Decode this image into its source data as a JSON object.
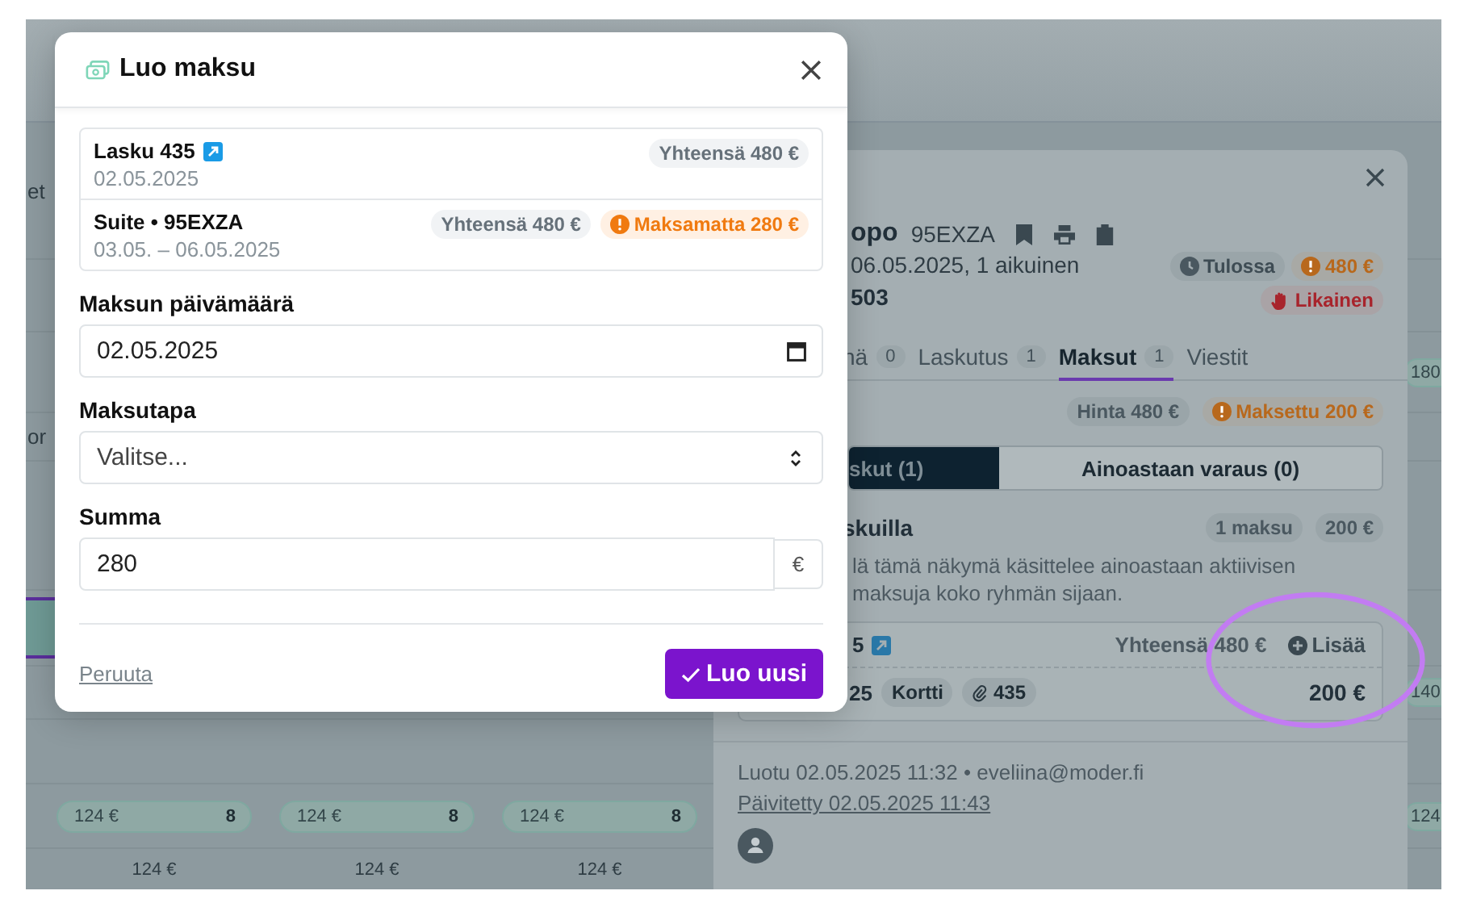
{
  "background": {
    "edge_labels": [
      "et",
      "or"
    ],
    "side_pills": [
      "180",
      "140",
      "124"
    ],
    "price_pills": [
      {
        "price": "124 €",
        "count": "8"
      },
      {
        "price": "124 €",
        "count": "8"
      },
      {
        "price": "124 €",
        "count": "8"
      }
    ],
    "row_prices": [
      "124 €",
      "124 €",
      "124 €"
    ]
  },
  "detail_panel": {
    "title": "opo",
    "code": "95EXZA",
    "dates": "06.05.2025, 1 aikuinen",
    "room": "503",
    "badges": [
      {
        "kind": "status",
        "text": "Tulossa"
      },
      {
        "kind": "warning",
        "text": "480 €"
      },
      {
        "kind": "danger",
        "text": "Likainen"
      }
    ],
    "tabs": [
      {
        "label": "nä",
        "count": "0",
        "selected": false
      },
      {
        "label": "Laskutus",
        "count": "1",
        "selected": false
      },
      {
        "label": "Maksut",
        "count": "1",
        "selected": true
      },
      {
        "label": "Viestit",
        "selected": false
      }
    ],
    "summary": [
      {
        "kind": "neutral",
        "text": "Hinta 480 €"
      },
      {
        "kind": "warning",
        "text": "Maksettu 200 €"
      }
    ],
    "segments": [
      {
        "label": "skut (1)",
        "selected": true
      },
      {
        "label": "Ainoastaan varaus (0)",
        "selected": false
      }
    ],
    "section": {
      "title": "skuilla",
      "badges": [
        "1 maksu",
        "200 €"
      ],
      "note": "lä tämä näkymä käsittelee ainoastaan aktiivisen\nmaksuja koko ryhmän sijaan."
    },
    "invoice_card": {
      "title": "5",
      "link": true,
      "total": "Yhteensä 480 €",
      "add": "Lisää",
      "payment": {
        "date": "25",
        "method": "Kortti",
        "invoice": "435",
        "amount": "200 €"
      }
    },
    "footer": {
      "created": "Luotu 02.05.2025 11:32 • eveliina@moder.fi",
      "updated": "Päivitetty 02.05.2025 11:43"
    }
  },
  "dialog": {
    "title": "Luo maksu",
    "items": [
      {
        "title": "Lasku 435",
        "link": true,
        "subtitle": "02.05.2025",
        "badges": [
          {
            "kind": "neutral",
            "text": "Yhteensä 480 €"
          }
        ]
      },
      {
        "title": "Suite • 95EXZA",
        "link": false,
        "subtitle": "03.05. – 06.05.2025",
        "badges": [
          {
            "kind": "neutral",
            "text": "Yhteensä 480 €"
          },
          {
            "kind": "warning",
            "text": "Maksamatta 280 €"
          }
        ]
      }
    ],
    "fields": [
      {
        "kind": "date",
        "label": "Maksun päivämäärä",
        "value": "02.05.2025"
      },
      {
        "kind": "select",
        "label": "Maksutapa",
        "placeholder": "Valitse..."
      },
      {
        "kind": "amount",
        "label": "Summa",
        "value": "280",
        "suffix": "€"
      }
    ],
    "cancel": "Peruuta",
    "submit": "Luo uusi"
  },
  "annotation": {
    "kind": "ellipse"
  }
}
